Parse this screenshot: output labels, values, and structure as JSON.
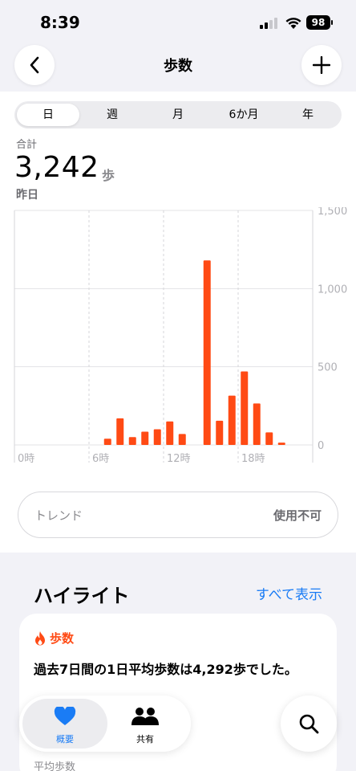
{
  "status": {
    "time": "8:39",
    "battery": "98"
  },
  "nav": {
    "title": "歩数"
  },
  "segments": [
    "日",
    "週",
    "月",
    "6か月",
    "年"
  ],
  "summary": {
    "label": "合計",
    "value": "3,242",
    "unit": "歩",
    "date": "昨日"
  },
  "chart_data": {
    "type": "bar",
    "x_ticks": [
      "0時",
      "6時",
      "12時",
      "18時"
    ],
    "y_ticks": [
      "1,500",
      "1,000",
      "500",
      "0"
    ],
    "ylim": [
      0,
      1500
    ],
    "xlim": [
      0,
      24
    ],
    "grid": true,
    "bar_color": "#ff4a14",
    "points": [
      {
        "hour": 7,
        "value": 40
      },
      {
        "hour": 8,
        "value": 170
      },
      {
        "hour": 9,
        "value": 50
      },
      {
        "hour": 10,
        "value": 85
      },
      {
        "hour": 11,
        "value": 100
      },
      {
        "hour": 12,
        "value": 150
      },
      {
        "hour": 13,
        "value": 70
      },
      {
        "hour": 15,
        "value": 1180
      },
      {
        "hour": 16,
        "value": 155
      },
      {
        "hour": 17,
        "value": 315
      },
      {
        "hour": 18,
        "value": 470
      },
      {
        "hour": 19,
        "value": 265
      },
      {
        "hour": 20,
        "value": 80
      },
      {
        "hour": 21,
        "value": 15
      }
    ]
  },
  "trend": {
    "label": "トレンド",
    "status": "使用不可"
  },
  "highlights": {
    "title": "ハイライト",
    "show_all": "すべて表示",
    "card": {
      "category": "歩数",
      "message": "過去7日間の1日平均歩数は4,292歩でした。",
      "sub": "平均歩数"
    }
  },
  "tabs": [
    {
      "label": "概要",
      "icon": "heart-icon"
    },
    {
      "label": "共有",
      "icon": "people-icon"
    }
  ],
  "colors": {
    "accent": "#ff4a14",
    "link": "#1a7cf5",
    "tab_active": "#1a7cf5"
  }
}
